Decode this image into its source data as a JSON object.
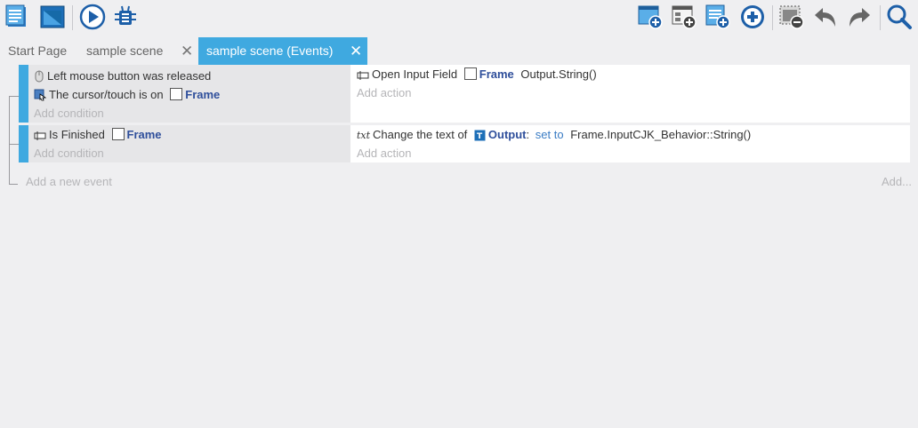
{
  "toolbar": {
    "left_icons": [
      "events-list-icon",
      "scene-window-icon",
      "preview-play-icon",
      "debugger-icon"
    ],
    "right_icons": [
      "add-event-icon",
      "add-subevent-icon",
      "add-comment-icon",
      "add-more-icon",
      "delete-event-icon",
      "undo-icon",
      "redo-icon",
      "search-icon"
    ]
  },
  "tabs": [
    {
      "label": "Start Page",
      "closable": false,
      "active": false
    },
    {
      "label": "sample scene",
      "closable": true,
      "active": false
    },
    {
      "label": "sample scene (Events)",
      "closable": true,
      "active": true
    }
  ],
  "close_glyph": "✕",
  "events": [
    {
      "conditions": [
        {
          "text": "Left mouse button was released"
        },
        {
          "text": "The cursor/touch is on",
          "object": "Frame"
        }
      ],
      "add_condition": "Add condition",
      "actions": [
        {
          "text": "Open Input Field",
          "object": "Frame",
          "extra": "Output.String()"
        }
      ],
      "add_action": "Add action"
    },
    {
      "conditions": [
        {
          "text": "Is Finished",
          "object": "Frame"
        }
      ],
      "add_condition": "Add condition",
      "actions": [
        {
          "text": "Change the text of",
          "object": "Output",
          "colon": ":",
          "link": "set to",
          "extra": "Frame.InputCJK_Behavior::String()"
        }
      ],
      "add_action": "Add action"
    }
  ],
  "add_event": "Add a new event",
  "add_more": "Add...",
  "colors": {
    "accent": "#3fa9e0",
    "object": "#2f4f9b",
    "link": "#3a7cc4",
    "placeholder": "#b5b5b8"
  }
}
